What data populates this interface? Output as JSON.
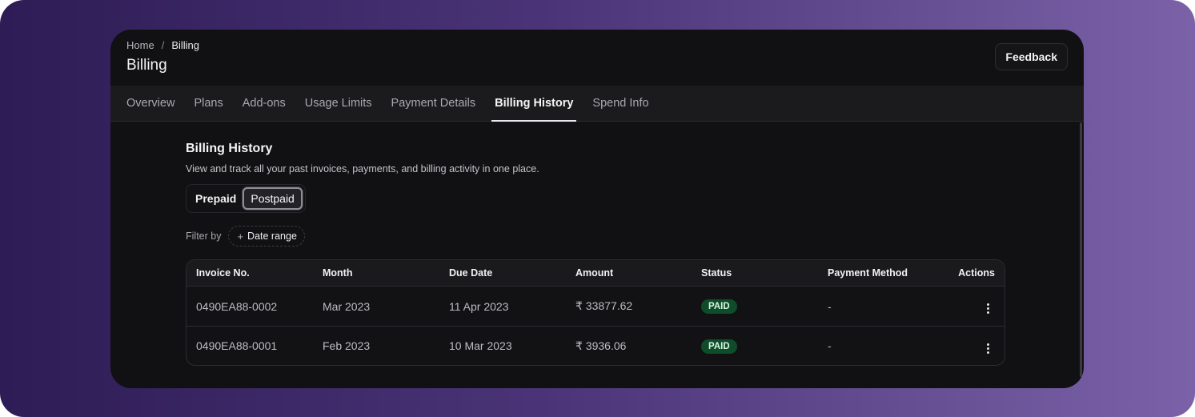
{
  "breadcrumb": {
    "home": "Home",
    "separator": "/",
    "current": "Billing"
  },
  "header": {
    "title": "Billing",
    "feedback_label": "Feedback"
  },
  "tabs": [
    {
      "label": "Overview",
      "active": false
    },
    {
      "label": "Plans",
      "active": false
    },
    {
      "label": "Add-ons",
      "active": false
    },
    {
      "label": "Usage Limits",
      "active": false
    },
    {
      "label": "Payment Details",
      "active": false
    },
    {
      "label": "Billing History",
      "active": true
    },
    {
      "label": "Spend Info",
      "active": false
    }
  ],
  "section": {
    "title": "Billing History",
    "description": "View and track all your past invoices, payments, and billing activity in one place."
  },
  "toggle": {
    "prepaid": "Prepaid",
    "postpaid": "Postpaid",
    "selected": "Postpaid"
  },
  "filter": {
    "label": "Filter by",
    "chip_icon": "+",
    "chip_label": "Date range"
  },
  "table": {
    "columns": [
      "Invoice No.",
      "Month",
      "Due Date",
      "Amount",
      "Status",
      "Payment Method",
      "Actions"
    ],
    "rows": [
      {
        "invoice": "0490EA88-0002",
        "month": "Mar 2023",
        "due_date": "11 Apr 2023",
        "amount": "₹ 33877.62",
        "status": "PAID",
        "payment_method": "-"
      },
      {
        "invoice": "0490EA88-0001",
        "month": "Feb 2023",
        "due_date": "10 Mar 2023",
        "amount": "₹ 3936.06",
        "status": "PAID",
        "payment_method": "-"
      }
    ]
  },
  "colors": {
    "background_gradient_start": "#2d1c55",
    "background_gradient_end": "#7b62a8",
    "panel": "#111113",
    "status_paid_bg": "#0f4d2a"
  },
  "icons": {
    "row_actions": "more-vertical-icon",
    "filter_add": "plus-icon"
  }
}
